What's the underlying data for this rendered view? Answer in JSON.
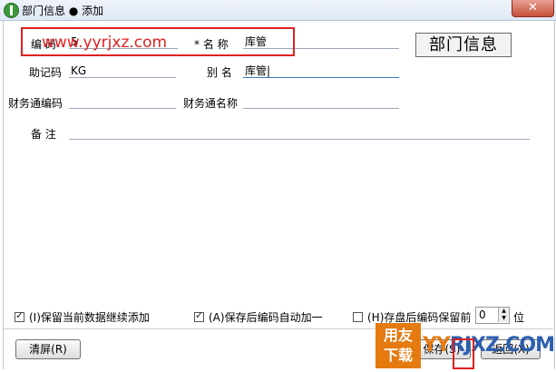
{
  "window": {
    "title": "部门信息 ● 添加",
    "close_label": "✕"
  },
  "watermark": {
    "url_text": "www.yyrjxz.com",
    "stamp_text": "部门信息"
  },
  "form": {
    "code_label": "编  码",
    "code_value": "5",
    "name_label": "* 名  称",
    "name_value": "库管",
    "mnemonic_label": "助记码",
    "mnemonic_value": "KG",
    "alias_label": "别  名",
    "alias_value": "库管|",
    "fin_code_label": "财务通编码",
    "fin_code_value": "",
    "fin_name_label": "财务通名称",
    "fin_name_value": "",
    "remark_label": "备  注",
    "remark_value": ""
  },
  "options": {
    "keep_data": {
      "label": "(I)保留当前数据继续添加",
      "checked": true
    },
    "auto_increment": {
      "label": "(A)保存后编码自动加一",
      "checked": true
    },
    "keep_prefix": {
      "label": "(H)存盘后编码保留前",
      "checked": false
    },
    "prefix_count": "0",
    "prefix_unit": "位"
  },
  "buttons": {
    "clear": "清屏(R)",
    "save": "保存(S)",
    "back": "返回(X)"
  },
  "logo": {
    "cn_top": "用友",
    "cn_bottom": "下载",
    "text_y1": "YY",
    "text_rest": "RJXZ.COM"
  },
  "colors": {
    "watermark_red": "#e02020",
    "accent_orange": "#e57a10"
  }
}
